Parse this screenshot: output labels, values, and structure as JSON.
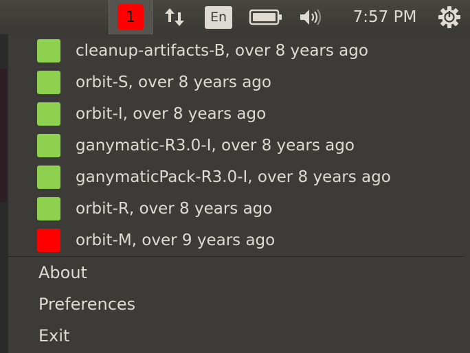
{
  "panel": {
    "notification_count": "1",
    "notification_color": "#ff0000",
    "network_icon": "network-up-down-icon",
    "keyboard_layout": "En",
    "battery_icon": "battery-icon",
    "volume_icon": "volume-icon",
    "clock": "7:57 PM",
    "session_icon": "gear-power-icon"
  },
  "menu": {
    "jobs": [
      {
        "label": "cleanup-artifacts-B, over 8 years ago",
        "status": "success",
        "color": "#8ed14e"
      },
      {
        "label": "orbit-S, over 8 years ago",
        "status": "success",
        "color": "#8ed14e"
      },
      {
        "label": "orbit-I, over 8 years ago",
        "status": "success",
        "color": "#8ed14e"
      },
      {
        "label": "ganymatic-R3.0-I, over 8 years ago",
        "status": "success",
        "color": "#8ed14e"
      },
      {
        "label": "ganymaticPack-R3.0-I, over 8 years ago",
        "status": "success",
        "color": "#8ed14e"
      },
      {
        "label": "orbit-R, over 8 years ago",
        "status": "success",
        "color": "#8ed14e"
      },
      {
        "label": "orbit-M, over 9 years ago",
        "status": "failure",
        "color": "#ff0000"
      }
    ],
    "actions": {
      "about": "About",
      "preferences": "Preferences",
      "exit": "Exit"
    }
  }
}
